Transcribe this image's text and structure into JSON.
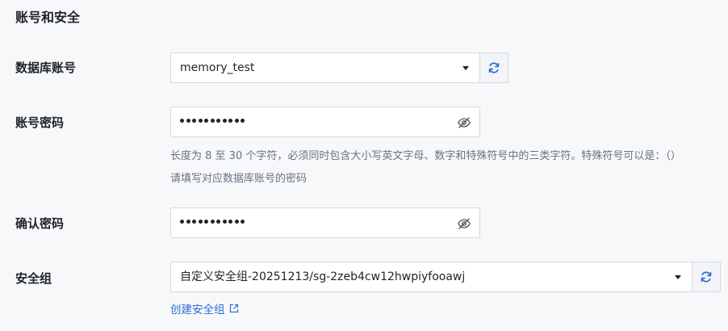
{
  "section": {
    "title": "账号和安全"
  },
  "account": {
    "label": "数据库账号",
    "value": "memory_test",
    "refresh_icon": "refresh-icon"
  },
  "password": {
    "label": "账号密码",
    "masked_length": 11,
    "toggle_icon": "eye-off-icon",
    "hint_rule": "长度为 8 至 30 个字符，必须同时包含大小写英文字母、数字和特殊符号中的三类字符。特殊符号可以是：（）",
    "hint_fill": "请填写对应数据库账号的密码"
  },
  "confirm_password": {
    "label": "确认密码",
    "masked_length": 11,
    "toggle_icon": "eye-off-icon"
  },
  "security_group": {
    "label": "安全组",
    "value": "自定义安全组-20251213/sg-2zeb4cw12hwpiyfooawj",
    "refresh_icon": "refresh-icon",
    "create_link": "创建安全组",
    "external_icon": "external-link-icon"
  },
  "colors": {
    "accent": "#2b6fd6",
    "background": "#f7f8fa",
    "border": "#d5d8de"
  }
}
